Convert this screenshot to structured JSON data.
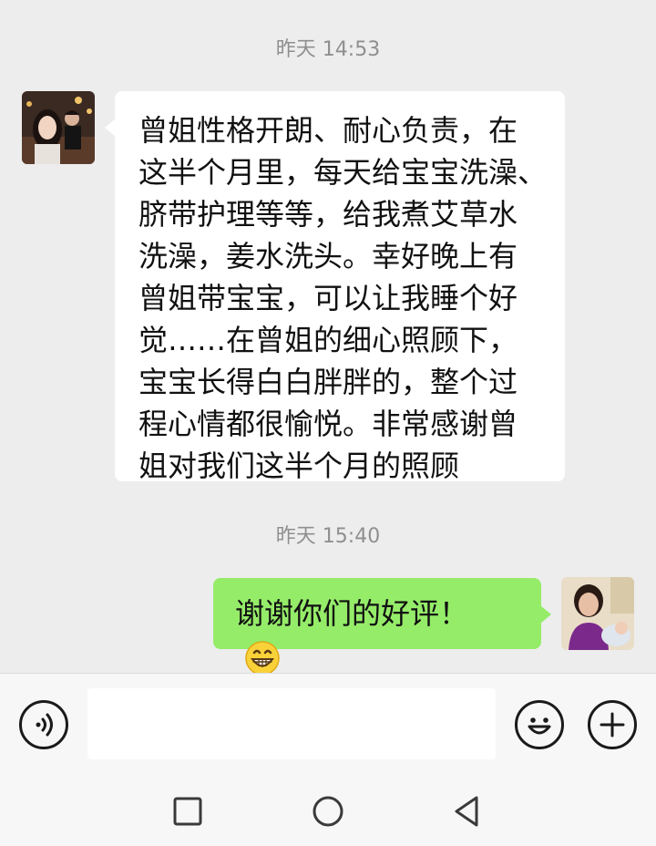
{
  "messages": [
    {
      "time": "昨天 14:53",
      "side": "left",
      "lines": [
        "曾姐性格开朗、耐心负责，在",
        "这半个月里，每天给宝宝洗澡、",
        "脐带护理等等，给我煮艾草水",
        "洗澡，姜水洗头。幸好晚上有",
        "曾姐带宝宝，可以让我睡个好",
        "觉……在曾姐的细心照顾下，",
        "宝宝长得白白胖胖的，整个过",
        "程心情都很愉悦。非常感谢曾",
        "姐对我们这半个月的照顾"
      ]
    },
    {
      "time": "昨天 15:40",
      "side": "right",
      "text": "谢谢你们的好评！",
      "emoji": "grinning-emoji"
    }
  ],
  "input": {
    "value": "",
    "placeholder": ""
  },
  "icons": {
    "voice": "voice-icon",
    "emoji": "emoji-icon",
    "add": "plus-icon",
    "nav_recent": "square-icon",
    "nav_home": "circle-icon",
    "nav_back": "triangle-icon"
  },
  "colors": {
    "chat_bg": "#ededed",
    "bubble_received": "#ffffff",
    "bubble_sent": "#95ec69",
    "timestamp": "#8f8f8f"
  }
}
